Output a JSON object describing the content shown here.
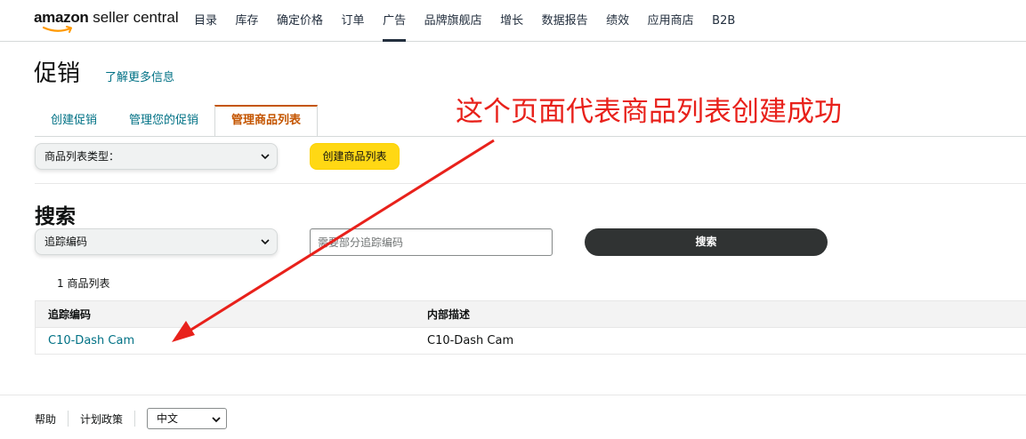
{
  "header": {
    "logo_brand": "amazon",
    "logo_suffix": " seller central",
    "nav": [
      "目录",
      "库存",
      "确定价格",
      "订单",
      "广告",
      "品牌旗舰店",
      "增长",
      "数据报告",
      "绩效",
      "应用商店",
      "B2B"
    ],
    "active_nav_index": 4
  },
  "page": {
    "title": "促销",
    "learn_more": "了解更多信息"
  },
  "tabs": [
    "创建促销",
    "管理您的促销",
    "管理商品列表"
  ],
  "active_tab_index": 2,
  "toolbar": {
    "list_type_select": "商品列表类型：",
    "create_button": "创建商品列表"
  },
  "search": {
    "title": "搜索",
    "field_select": "追踪编码",
    "input_placeholder": "需要部分追踪编码",
    "input_value": "",
    "button": "搜索"
  },
  "results": {
    "count_label": "1 商品列表",
    "columns": [
      "追踪编码",
      "内部描述"
    ],
    "rows": [
      {
        "tracking_code": "C10-Dash Cam",
        "description": "C10-Dash Cam"
      }
    ]
  },
  "footer": {
    "help": "帮助",
    "program_policy": "计划政策",
    "language": "中文"
  },
  "annotation": {
    "text": "这个页面代表商品列表创建成功",
    "color": "#e8211b"
  },
  "colors": {
    "link": "#007185",
    "active_tab": "#c45500",
    "button_yellow": "#ffd814",
    "button_dark": "#303333"
  }
}
